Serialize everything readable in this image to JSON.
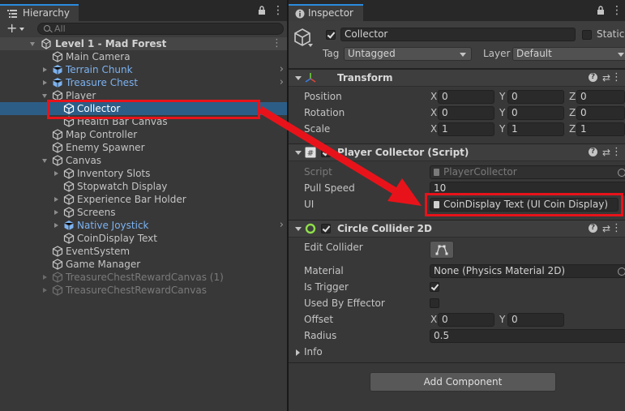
{
  "hierarchy": {
    "tab_label": "Hierarchy",
    "lock_glyph": "🔒",
    "menu_glyph": "⋮",
    "add_glyph": "+",
    "search_placeholder": "All",
    "scene_name": "Level 1 - Mad Forest",
    "items": [
      {
        "label": "Main Camera"
      },
      {
        "label": "Terrain Chunk"
      },
      {
        "label": "Treasure Chest"
      },
      {
        "label": "Player"
      },
      {
        "label": "Collector"
      },
      {
        "label": "Health Bar Canvas"
      },
      {
        "label": "Map Controller"
      },
      {
        "label": "Enemy Spawner"
      },
      {
        "label": "Canvas"
      },
      {
        "label": "Inventory Slots"
      },
      {
        "label": "Stopwatch Display"
      },
      {
        "label": "Experience Bar Holder"
      },
      {
        "label": "Screens"
      },
      {
        "label": "Native Joystick"
      },
      {
        "label": "CoinDisplay Text"
      },
      {
        "label": "EventSystem"
      },
      {
        "label": "Game Manager"
      },
      {
        "label": "TreasureChestRewardCanvas (1)"
      },
      {
        "label": "TreasureChestRewardCanvas"
      }
    ]
  },
  "inspector": {
    "tab_label": "Inspector",
    "object_name": "Collector",
    "static_label": "Static",
    "tag_label": "Tag",
    "tag_value": "Untagged",
    "layer_label": "Layer",
    "layer_value": "Default",
    "transform": {
      "title": "Transform",
      "position_label": "Position",
      "rotation_label": "Rotation",
      "scale_label": "Scale",
      "x_label": "X",
      "y_label": "Y",
      "z_label": "Z",
      "position": {
        "x": "0",
        "y": "0",
        "z": "0"
      },
      "rotation": {
        "x": "0",
        "y": "0",
        "z": "0"
      },
      "scale": {
        "x": "1",
        "y": "1",
        "z": "1"
      }
    },
    "player_collector": {
      "title": "Player Collector (Script)",
      "script_label": "Script",
      "script_value": "PlayerCollector",
      "pull_speed_label": "Pull Speed",
      "pull_speed_value": "10",
      "ui_label": "UI",
      "ui_value": "CoinDisplay Text (UI Coin Display)"
    },
    "circle_collider": {
      "title": "Circle Collider 2D",
      "edit_collider_label": "Edit Collider",
      "material_label": "Material",
      "material_value": "None (Physics Material 2D)",
      "is_trigger_label": "Is Trigger",
      "used_by_effector_label": "Used By Effector",
      "offset_label": "Offset",
      "offset_x": "0",
      "offset_y": "0",
      "radius_label": "Radius",
      "radius_value": "0.5",
      "info_label": "Info"
    },
    "add_component_label": "Add Component",
    "help_glyph": "?",
    "preset_glyph": "⇄",
    "menu_glyph": "⋮"
  },
  "colors": {
    "highlight_red": "#e8131a",
    "selection_blue": "#2c5d87",
    "prefab_blue": "#7cb2f0"
  }
}
